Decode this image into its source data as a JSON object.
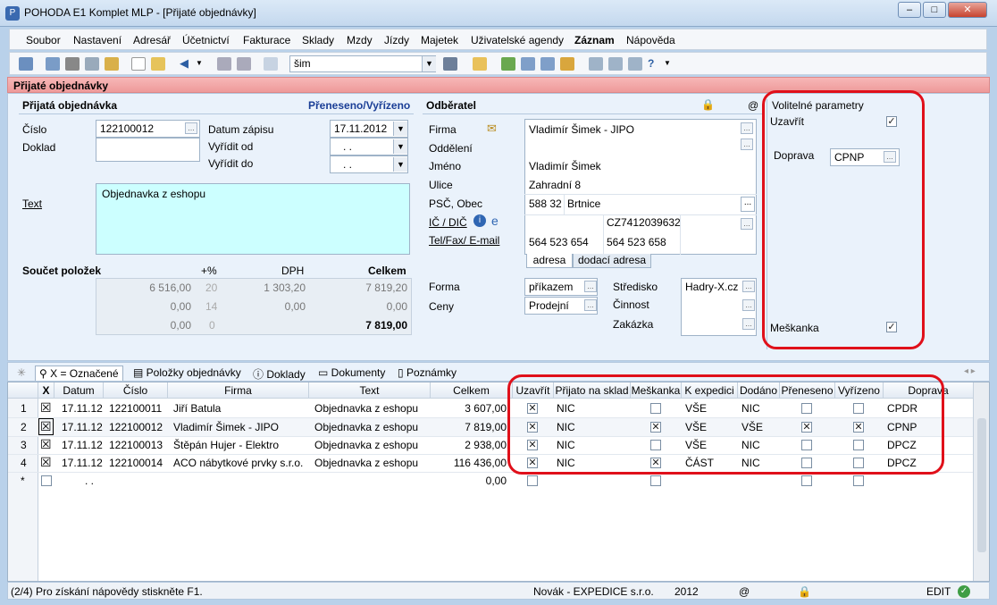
{
  "window": {
    "title": "POHODA E1 Komplet MLP - [Přijaté objednávky]"
  },
  "menu": [
    "Soubor",
    "Nastavení",
    "Adresář",
    "Účetnictví",
    "Fakturace",
    "Sklady",
    "Mzdy",
    "Jízdy",
    "Majetek",
    "Uživatelské agendy",
    "Záznam",
    "Nápověda"
  ],
  "toolbar": {
    "search_value": "šim"
  },
  "agenda_title": "Přijaté objednávky",
  "order": {
    "section": "Přijatá objednávka",
    "status_link": "Přeneseno/Vyřízeno",
    "cislo_label": "Číslo",
    "cislo": "122100012",
    "doklad_label": "Doklad",
    "datum_zapisu_label": "Datum zápisu",
    "datum_zapisu": "17.11.2012",
    "vyridit_od_label": "Vyřídit od",
    "vyridit_od": ". .",
    "vyridit_do_label": "Vyřídit do",
    "vyridit_do": ". .",
    "text_label": "Text",
    "text": "Objednavka z eshopu"
  },
  "totals": {
    "label": "Součet položek",
    "h_pct": "+%",
    "h_dph": "DPH",
    "h_celkem": "Celkem",
    "rows": [
      [
        "6 516,00",
        "20",
        "1 303,20",
        "7 819,20"
      ],
      [
        "0,00",
        "14",
        "0,00",
        "0,00"
      ],
      [
        "0,00",
        "0",
        "",
        "7 819,00"
      ]
    ]
  },
  "customer": {
    "section": "Odběratel",
    "firma_label": "Firma",
    "firma": "Vladimír Šimek - JIPO",
    "oddeleni_label": "Oddělení",
    "jmeno_label": "Jméno",
    "jmeno": "Vladimír Šimek",
    "ulice_label": "Ulice",
    "ulice": "Zahradní 8",
    "psc_label": "PSČ, Obec",
    "psc": "588 32",
    "obec": "Brtnice",
    "ic_label": "IČ / DIČ",
    "dic": "CZ7412039632",
    "tel_label": "Tel/Fax/ E-mail",
    "tel": "564 523 654",
    "fax": "564 523 658",
    "tab_adresa": "adresa",
    "tab_dodaci": "dodací adresa"
  },
  "other": {
    "forma_label": "Forma",
    "forma": "příkazem",
    "ceny_label": "Ceny",
    "ceny": "Prodejní",
    "stredisko_label": "Středisko",
    "stredisko": "Hadry-X.cz",
    "cinnost_label": "Činnost",
    "zakazka_label": "Zakázka"
  },
  "params": {
    "title": "Volitelné parametry",
    "uzavrit_label": "Uzavřít",
    "uzavrit": "✓",
    "doprava_label": "Doprava",
    "doprava": "CPNP",
    "meskanka_label": "Meškanka",
    "meskanka": "✓"
  },
  "tabs": [
    "X = Označené",
    "Položky objednávky",
    "Doklady",
    "Dokumenty",
    "Poznámky"
  ],
  "grid": {
    "headers": [
      "X",
      "Datum",
      "Číslo",
      "Firma",
      "Text",
      "Celkem",
      "Uzavřít",
      "Přijato na sklad",
      "Meškanka",
      "K expedici",
      "Dodáno",
      "Přeneseno",
      "Vyřízeno",
      "Doprava"
    ],
    "rows": [
      {
        "n": "1",
        "x": "☒",
        "datum": "17.11.12",
        "cislo": "122100011",
        "firma": "Jiří Batula",
        "text": "Objednavka z eshopu",
        "celkem": "3 607,00",
        "uzavrit": "✕",
        "prijato": "NIC",
        "meskanka": "",
        "expedice": "VŠE",
        "dodano": "NIC",
        "preneseno": "",
        "vyrizeno": "",
        "doprava": "CPDR"
      },
      {
        "n": "2",
        "x": "☒",
        "datum": "17.11.12",
        "cislo": "122100012",
        "firma": "Vladimír Šimek - JIPO",
        "text": "Objednavka z eshopu",
        "celkem": "7 819,00",
        "uzavrit": "✕",
        "prijato": "NIC",
        "meskanka": "✕",
        "expedice": "VŠE",
        "dodano": "VŠE",
        "preneseno": "✕",
        "vyrizeno": "✕",
        "doprava": "CPNP"
      },
      {
        "n": "3",
        "x": "☒",
        "datum": "17.11.12",
        "cislo": "122100013",
        "firma": "Štěpán Hujer - Elektro",
        "text": "Objednavka z eshopu",
        "celkem": "2 938,00",
        "uzavrit": "✕",
        "prijato": "NIC",
        "meskanka": "",
        "expedice": "VŠE",
        "dodano": "NIC",
        "preneseno": "",
        "vyrizeno": "",
        "doprava": "DPCZ"
      },
      {
        "n": "4",
        "x": "☒",
        "datum": "17.11.12",
        "cislo": "122100014",
        "firma": "ACO nábytkové prvky s.r.o.",
        "text": "Objednavka z eshopu",
        "celkem": "116 436,00",
        "uzavrit": "✕",
        "prijato": "NIC",
        "meskanka": "✕",
        "expedice": "ČÁST",
        "dodano": "NIC",
        "preneseno": "",
        "vyrizeno": "",
        "doprava": "DPCZ"
      }
    ],
    "new_row": {
      "n": "*",
      "datum": ". .",
      "celkem": "0,00"
    }
  },
  "status": {
    "help": "(2/4) Pro získání nápovědy stiskněte F1.",
    "user": "Novák - EXPEDICE s.r.o.",
    "year": "2012",
    "at": "@",
    "mode": "EDIT"
  },
  "colors": {
    "highlight": "#e0101a",
    "agenda_header": "#ee9a9a",
    "text_area": "#ccffff"
  }
}
